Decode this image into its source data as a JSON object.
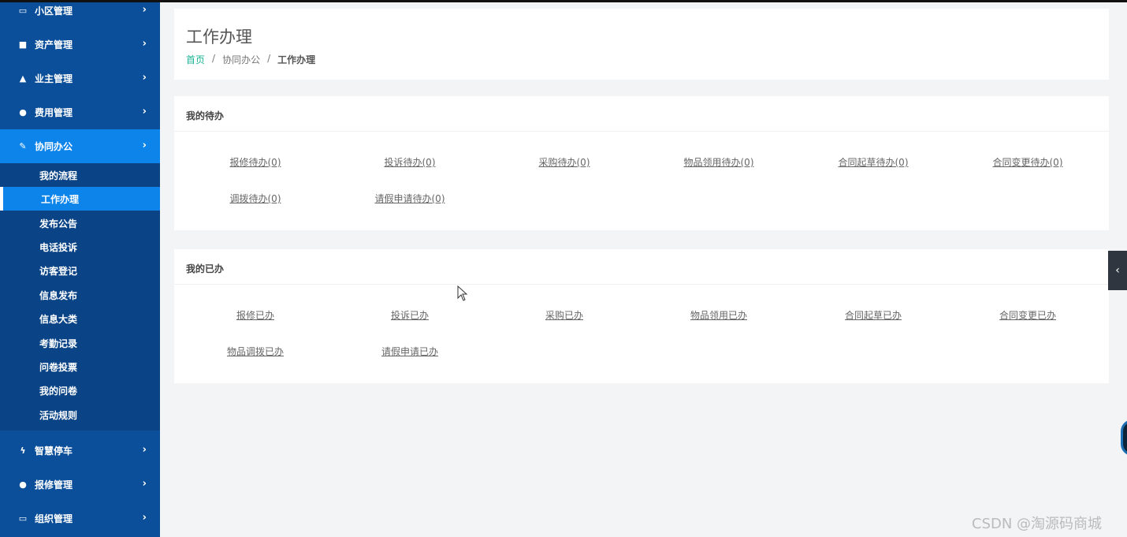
{
  "sidebar": {
    "items": [
      {
        "label": "小区管理",
        "icon": "laptop-icon",
        "glyph": "▭",
        "chevron": "›"
      },
      {
        "label": "资产管理",
        "icon": "grid-icon",
        "glyph": "■",
        "chevron": "›"
      },
      {
        "label": "业主管理",
        "icon": "flask-icon",
        "glyph": "▲",
        "chevron": "›"
      },
      {
        "label": "费用管理",
        "icon": "globe-icon",
        "glyph": "●",
        "chevron": "›"
      },
      {
        "label": "协同办公",
        "icon": "edit-icon",
        "glyph": "✎",
        "chevron": "›"
      },
      {
        "label": "智慧停车",
        "icon": "bolt-icon",
        "glyph": "ϟ",
        "chevron": "›"
      },
      {
        "label": "报修管理",
        "icon": "globe-icon",
        "glyph": "●",
        "chevron": "›"
      },
      {
        "label": "组织管理",
        "icon": "monitor-icon",
        "glyph": "▭",
        "chevron": "›"
      }
    ],
    "submenu": [
      {
        "label": "我的流程"
      },
      {
        "label": "工作办理"
      },
      {
        "label": "发布公告"
      },
      {
        "label": "电话投诉"
      },
      {
        "label": "访客登记"
      },
      {
        "label": "信息发布"
      },
      {
        "label": "信息大类"
      },
      {
        "label": "考勤记录"
      },
      {
        "label": "问卷投票"
      },
      {
        "label": "我的问卷"
      },
      {
        "label": "活动规则"
      }
    ]
  },
  "header": {
    "title": "工作办理",
    "breadcrumb": {
      "home": "首页",
      "sep": "/",
      "parent": "协同办公",
      "current": "工作办理"
    }
  },
  "todo": {
    "title": "我的待办",
    "links": [
      "报修待办(0)",
      "投诉待办(0)",
      "采购待办(0)",
      "物品领用待办(0)",
      "合同起草待办(0)",
      "合同变更待办(0)",
      "调拨待办(0)",
      "请假申请待办(0)"
    ]
  },
  "done": {
    "title": "我的已办",
    "links": [
      "报修已办",
      "投诉已办",
      "采购已办",
      "物品领用已办",
      "合同起草已办",
      "合同变更已办",
      "物品调拨已办",
      "请假申请已办"
    ]
  },
  "collapse_tab": {
    "icon": "chevron-left-icon",
    "glyph": "‹"
  },
  "watermark": "CSDN @淘源码商城",
  "colors": {
    "sidebar": "#0b4f9a",
    "active": "#0d84ea",
    "submenu": "#0a4486",
    "accent": "#1ab394"
  }
}
